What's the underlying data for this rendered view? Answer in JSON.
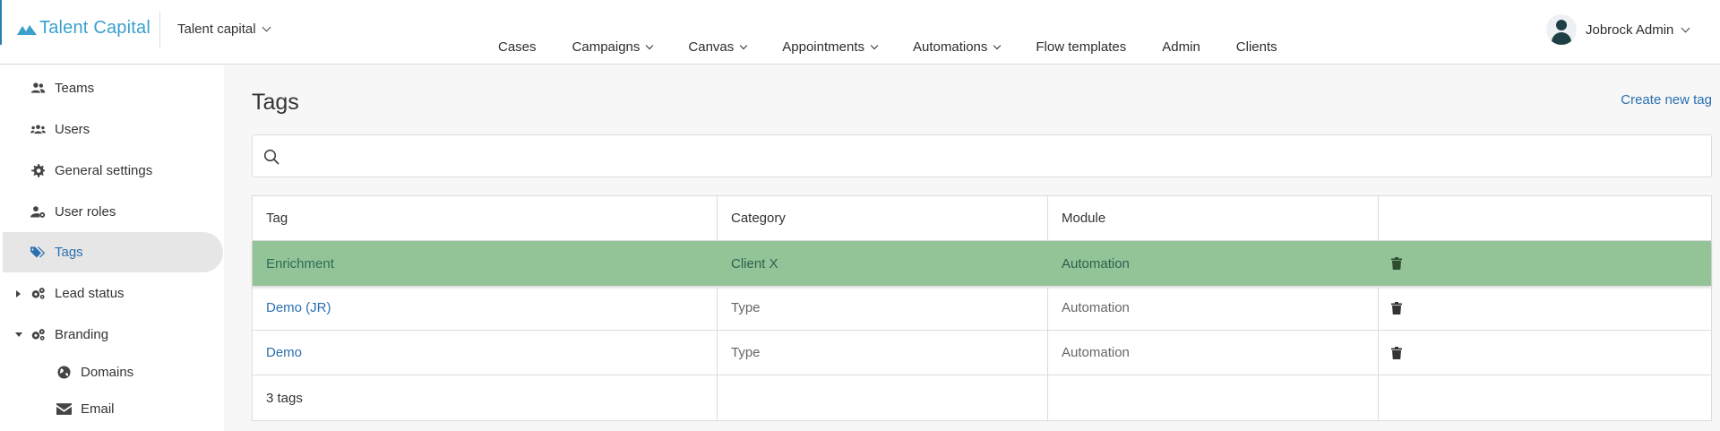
{
  "brand": {
    "name": "Talent Capital"
  },
  "workspace": {
    "label": "Talent capital"
  },
  "nav": [
    {
      "label": "Cases",
      "dropdown": false
    },
    {
      "label": "Campaigns",
      "dropdown": true
    },
    {
      "label": "Canvas",
      "dropdown": true
    },
    {
      "label": "Appointments",
      "dropdown": true
    },
    {
      "label": "Automations",
      "dropdown": true
    },
    {
      "label": "Flow templates",
      "dropdown": false
    },
    {
      "label": "Admin",
      "dropdown": false
    },
    {
      "label": "Clients",
      "dropdown": false
    }
  ],
  "user": {
    "name": "Jobrock Admin"
  },
  "sidebar": {
    "items": [
      {
        "label": "Teams",
        "icon": "users-icon"
      },
      {
        "label": "Users",
        "icon": "user-group-icon"
      },
      {
        "label": "General settings",
        "icon": "gear-icon"
      },
      {
        "label": "User roles",
        "icon": "user-cog-icon"
      },
      {
        "label": "Tags",
        "icon": "tags-icon",
        "active": true
      },
      {
        "label": "Lead status",
        "icon": "gears-icon",
        "expanded": false
      },
      {
        "label": "Branding",
        "icon": "gears-icon",
        "expanded": true
      },
      {
        "label": "Domains",
        "icon": "globe-icon"
      },
      {
        "label": "Email",
        "icon": "envelope-icon"
      }
    ]
  },
  "main": {
    "title": "Tags",
    "create_label": "Create new tag",
    "search_placeholder": "",
    "columns": [
      "Tag",
      "Category",
      "Module",
      ""
    ],
    "rows": [
      {
        "tag": "Enrichment",
        "category": "Client X",
        "module": "Automation",
        "highlighted": true
      },
      {
        "tag": "Demo (JR)",
        "category": "Type",
        "module": "Automation",
        "highlighted": false
      },
      {
        "tag": "Demo",
        "category": "Type",
        "module": "Automation",
        "highlighted": false
      }
    ],
    "footer": "3 tags"
  },
  "colors": {
    "accent": "#2a6fb0",
    "brand": "#3aa0cc",
    "highlight_row": "#93c497"
  }
}
